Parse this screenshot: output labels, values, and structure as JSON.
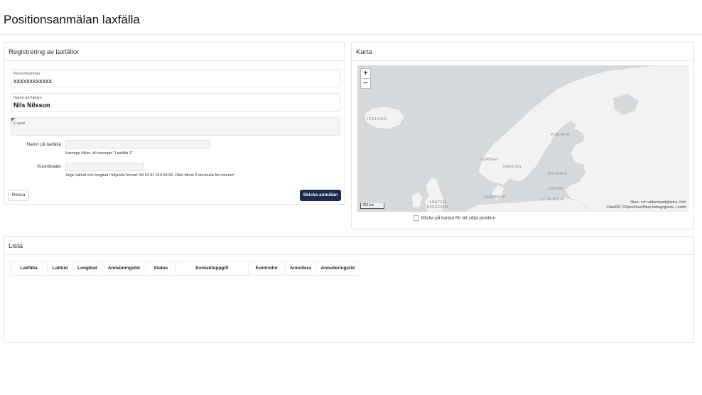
{
  "page_title": "Positionsanmälan laxfälla",
  "registration": {
    "title": "Registrering av laxfällor",
    "personnummer": {
      "label": "Personnummer",
      "value": "xxxxxxxxxxxx"
    },
    "fiskare": {
      "label": "Namn på fiskare",
      "value": "Nils Nilsson"
    },
    "epost": {
      "label": "E-post",
      "value": ""
    },
    "laxfalla": {
      "label": "Namn på laxfälla",
      "value": "",
      "help": "Namnge fällan, till exempel \"Laxfälla 1\""
    },
    "koordinater": {
      "label": "Koordinater",
      "value": "",
      "help": "Ange latitud och longitud i följande format: 58 53.91 010 59.86. Obs! Minst 2 decimala för minuter!"
    },
    "reset_label": "Rensa",
    "submit_label": "Skicka anmälan"
  },
  "map": {
    "title": "Karta",
    "zoom_in": "+",
    "zoom_out": "−",
    "scale": "300 km",
    "attribution_1": "Havs- och vattenmyndigheten, HaV",
    "attribution_2": "CartoDB, ©OpenStreetMaps bidragsgivare, Leaflet",
    "labels": {
      "iceland": "ICELAND",
      "finland": "FINLAND",
      "norway": "NORWAY",
      "sweden": "SWEDEN",
      "estonia": "ESTONIA",
      "latvia": "LATVIA",
      "denmark": "DENMARK",
      "lithuania": "LITHUANIA",
      "uk_1": "UNITED",
      "uk_2": "KINGDOM"
    },
    "checkbox_label": "Klicka på kartan för att välja position"
  },
  "list": {
    "title": "Lista",
    "columns": [
      "Laxfälla",
      "Latitud",
      "Longitud",
      "Anmälningstid",
      "Status",
      "Kontaktuppgift",
      "Kontrollnr",
      "Annullera",
      "Annulleringstid"
    ]
  },
  "colors": {
    "submit_bg": "#1c2b4a",
    "required_flag": "#d9363e",
    "map_water": "#d5d9dc",
    "map_land": "#f2f2f0"
  }
}
